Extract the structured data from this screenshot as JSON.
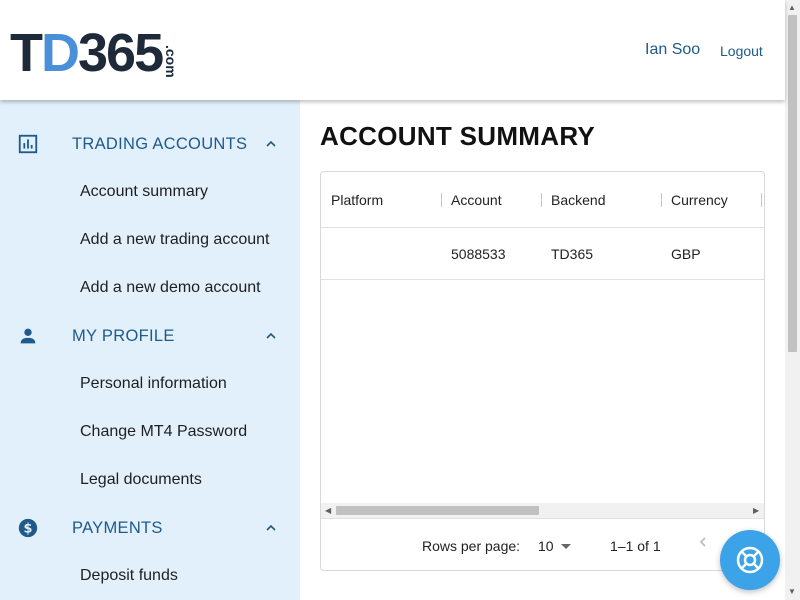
{
  "brand": {
    "logo_text_dark_1": "T",
    "logo_text_blue": "D",
    "logo_text_dark_2": "365",
    "logo_suffix": ".com"
  },
  "header": {
    "user_name": "Ian Soo",
    "logout_label": "Logout"
  },
  "sidebar": {
    "sections": [
      {
        "title": "TRADING ACCOUNTS",
        "icon": "bar-chart-icon",
        "items": [
          "Account summary",
          "Add a new trading account",
          "Add a new demo account"
        ]
      },
      {
        "title": "MY PROFILE",
        "icon": "person-icon",
        "items": [
          "Personal information",
          "Change MT4 Password",
          "Legal documents"
        ]
      },
      {
        "title": "PAYMENTS",
        "icon": "dollar-icon",
        "items": [
          "Deposit funds"
        ]
      }
    ]
  },
  "main": {
    "title": "ACCOUNT SUMMARY",
    "columns": [
      "Platform",
      "Account",
      "Backend",
      "Currency"
    ],
    "rows": [
      {
        "platform": "",
        "account": "5088533",
        "backend": "TD365",
        "currency": "GBP"
      }
    ],
    "footer": {
      "rows_per_page_label": "Rows per page:",
      "rows_per_page_value": "10",
      "range": "1–1 of 1"
    }
  },
  "colors": {
    "accent": "#1e5a8a",
    "sidebar_bg": "#e2f0fb",
    "help_bubble": "#3da3e8",
    "logo_blue": "#4a90d9",
    "logo_dark": "#1e2a3a"
  }
}
